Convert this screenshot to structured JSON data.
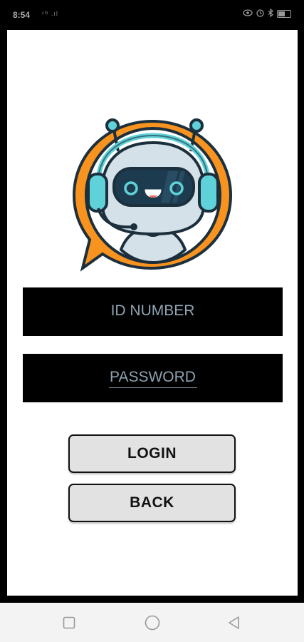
{
  "status_bar": {
    "time": "8:54",
    "signal_text": "⁴ᴳ .ıl",
    "battery_level": 0.6
  },
  "form": {
    "id_placeholder": "ID NUMBER",
    "password_placeholder": "PASSWORD"
  },
  "buttons": {
    "login_label": "LOGIN",
    "back_label": "BACK"
  },
  "colors": {
    "logo_orange": "#f7931e",
    "robot_face": "#d4e1e8",
    "visor": "#1d3b4f",
    "eye_cyan": "#5fd2d9",
    "outline": "#1c2f3d"
  },
  "icons": {
    "logo": "robot-headset-chat-icon",
    "nav_recents": "square-icon",
    "nav_home": "circle-icon",
    "nav_back": "triangle-back-icon"
  }
}
